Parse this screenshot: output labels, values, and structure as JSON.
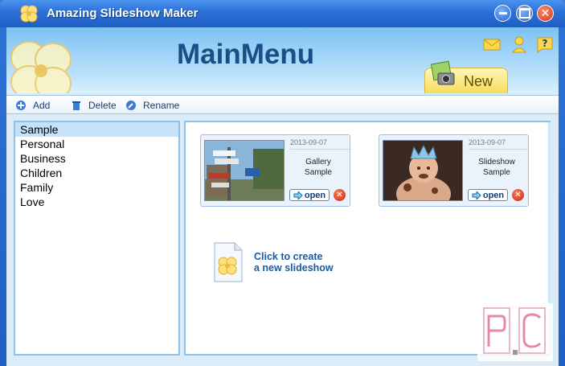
{
  "window": {
    "title": "Amazing Slideshow Maker"
  },
  "header": {
    "title": "MainMenu",
    "new_label": "New"
  },
  "toolbar": {
    "add_label": "Add",
    "delete_label": "Delete",
    "rename_label": "Rename"
  },
  "categories": [
    "Sample",
    "Personal",
    "Business",
    "Children",
    "Family",
    "Love"
  ],
  "selected_category": "Sample",
  "slideshows": [
    {
      "date": "2013-09-07",
      "name_line1": "Gallery",
      "name_line2": "Sample",
      "open_label": "open"
    },
    {
      "date": "2013-09-07",
      "name_line1": "Slideshow",
      "name_line2": "Sample",
      "open_label": "open"
    }
  ],
  "create": {
    "line1": "Click to create",
    "line2": "a new slideshow"
  },
  "colors": {
    "titlebar": "#2b6fd6",
    "header_title": "#1a4f86",
    "accent_text": "#1e5a9e",
    "panel_border": "#8fc0e8",
    "selected_row": "#c6e2f8"
  }
}
